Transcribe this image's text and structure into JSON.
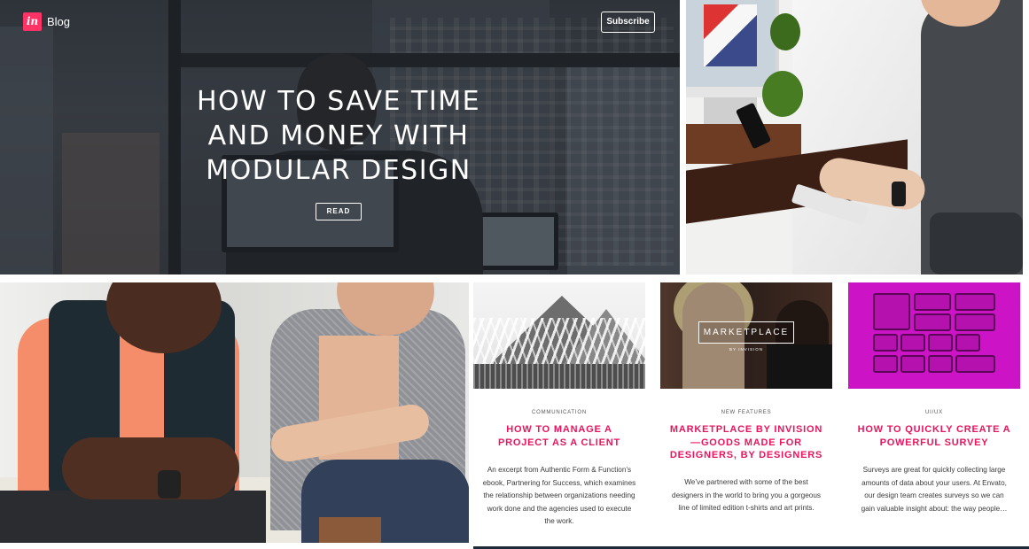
{
  "header": {
    "logo_text": "in",
    "blog_label": "Blog",
    "subscribe_label": "Subscribe"
  },
  "hero": {
    "title": "How to save time and money with modular design",
    "read_label": "READ"
  },
  "cards": [
    {
      "category": "COMMUNICATION",
      "title": "How to manage a project as a client",
      "excerpt": "An excerpt from Authentic Form & Function’s ebook, Partnering for Success, which examines the relationship between organizations needing work done and the agencies used to execute the work."
    },
    {
      "category": "NEW FEATURES",
      "title": "Marketplace by InVision —Goods made for designers, by designers",
      "excerpt": "We’ve partnered with some of the best designers in the world to bring you a gorgeous line of limited edition t-shirts and art prints.",
      "thumb_title": "MARKETPLACE",
      "thumb_subtitle": "BY INVISION"
    },
    {
      "category": "UI/UX",
      "title": "How to quickly create a powerful survey",
      "excerpt": "Surveys are great for quickly collecting large amounts of data about your users. At Envato, our design team creates surveys so we can gain valuable insight about: the way people…"
    }
  ],
  "colors": {
    "accent": "#e8145e",
    "logo_bg": "#ff3366",
    "survey_bg": "#cc14c6"
  }
}
